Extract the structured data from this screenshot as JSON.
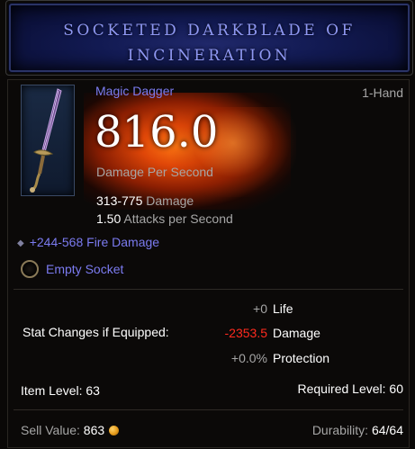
{
  "header": {
    "title_line1": "SOCKETED DARKBLADE OF",
    "title_line2": "INCINERATION"
  },
  "item": {
    "type": "Magic Dagger",
    "slot": "1-Hand",
    "icon": "dagger-icon",
    "dps": "816.0",
    "dps_label": "Damage Per Second",
    "damage_range": "313-775",
    "damage_label": "Damage",
    "attack_speed": "1.50",
    "attack_speed_label": "Attacks per Second"
  },
  "affixes": {
    "fire_damage": "+244-568 Fire Damage",
    "socket_label": "Empty Socket"
  },
  "stat_changes": {
    "header": "Stat Changes if Equipped:",
    "life_value": "+0",
    "life_label": "Life",
    "damage_value": "-2353.5",
    "damage_label": "Damage",
    "protection_value": "+0.0%",
    "protection_label": "Protection"
  },
  "levels": {
    "item_level": "Item Level: 63",
    "required_level": "Required Level: 60"
  },
  "footer": {
    "sell_label": "Sell Value:",
    "sell_value": "863",
    "durability_label": "Durability:",
    "durability_value": "64/64"
  },
  "colors": {
    "magic_blue": "#7b7bf0",
    "title_blue": "#8f98f2",
    "negative_red": "#ff2a1e",
    "label_gray": "#a6a6a6"
  }
}
